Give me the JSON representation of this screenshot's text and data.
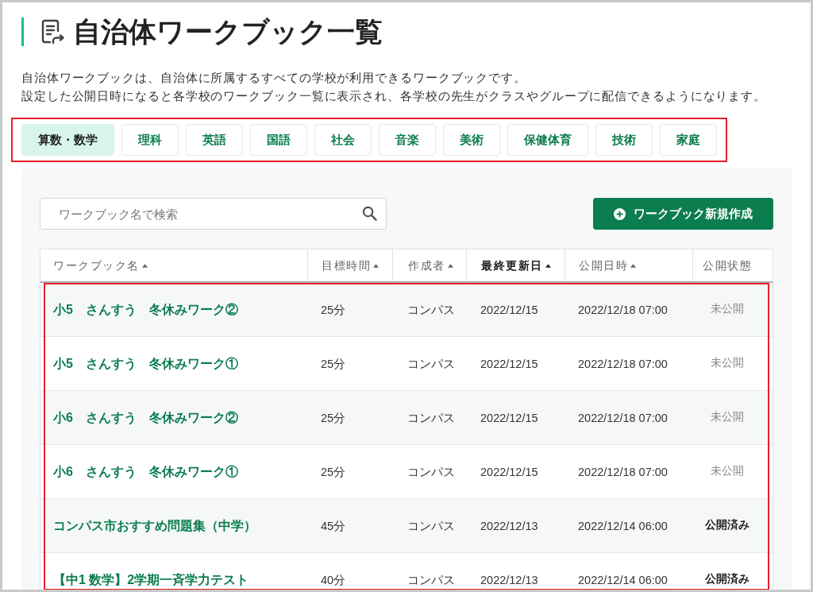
{
  "page": {
    "title": "自治体ワークブック一覧",
    "description": [
      "自治体ワークブックは、自治体に所属するすべての学校が利用できるワークブックです。",
      "設定した公開日時になると各学校のワークブック一覧に表示され、各学校の先生がクラスやグループに配信できるようになります。"
    ]
  },
  "subject_tabs": {
    "highlighted": true,
    "items": [
      {
        "label": "算数・数学",
        "selected": true
      },
      {
        "label": "理科",
        "selected": false
      },
      {
        "label": "英語",
        "selected": false
      },
      {
        "label": "国語",
        "selected": false
      },
      {
        "label": "社会",
        "selected": false
      },
      {
        "label": "音楽",
        "selected": false
      },
      {
        "label": "美術",
        "selected": false
      },
      {
        "label": "保健体育",
        "selected": false
      },
      {
        "label": "技術",
        "selected": false
      },
      {
        "label": "家庭",
        "selected": false
      }
    ]
  },
  "search": {
    "placeholder": "ワークブック名で検索"
  },
  "create_button": {
    "label": "ワークブック新規作成"
  },
  "table": {
    "columns": [
      {
        "label": "ワークブック名",
        "sortable": true,
        "selected": false
      },
      {
        "label": "目標時間",
        "sortable": true,
        "selected": false
      },
      {
        "label": "作成者",
        "sortable": true,
        "selected": false
      },
      {
        "label": "最終更新日",
        "sortable": true,
        "selected": true
      },
      {
        "label": "公開日時",
        "sortable": true,
        "selected": false
      },
      {
        "label": "公開状態",
        "sortable": false,
        "selected": false
      }
    ],
    "rows_highlighted": true,
    "rows": [
      {
        "name": "小5　さんすう　冬休みワーク②",
        "target_time": "25分",
        "author": "コンパス",
        "updated": "2022/12/15",
        "publish_at": "2022/12/18 07:00",
        "status": "未公開",
        "published": false
      },
      {
        "name": "小5　さんすう　冬休みワーク①",
        "target_time": "25分",
        "author": "コンパス",
        "updated": "2022/12/15",
        "publish_at": "2022/12/18 07:00",
        "status": "未公開",
        "published": false
      },
      {
        "name": "小6　さんすう　冬休みワーク②",
        "target_time": "25分",
        "author": "コンパス",
        "updated": "2022/12/15",
        "publish_at": "2022/12/18 07:00",
        "status": "未公開",
        "published": false
      },
      {
        "name": "小6　さんすう　冬休みワーク①",
        "target_time": "25分",
        "author": "コンパス",
        "updated": "2022/12/15",
        "publish_at": "2022/12/18 07:00",
        "status": "未公開",
        "published": false
      },
      {
        "name": "コンパス市おすすめ問題集（中学）",
        "target_time": "45分",
        "author": "コンパス",
        "updated": "2022/12/13",
        "publish_at": "2022/12/14 06:00",
        "status": "公開済み",
        "published": true
      },
      {
        "name": "【中1 数学】2学期一斉学力テスト",
        "target_time": "40分",
        "author": "コンパス",
        "updated": "2022/12/13",
        "publish_at": "2022/12/14 06:00",
        "status": "公開済み",
        "published": true
      }
    ]
  }
}
